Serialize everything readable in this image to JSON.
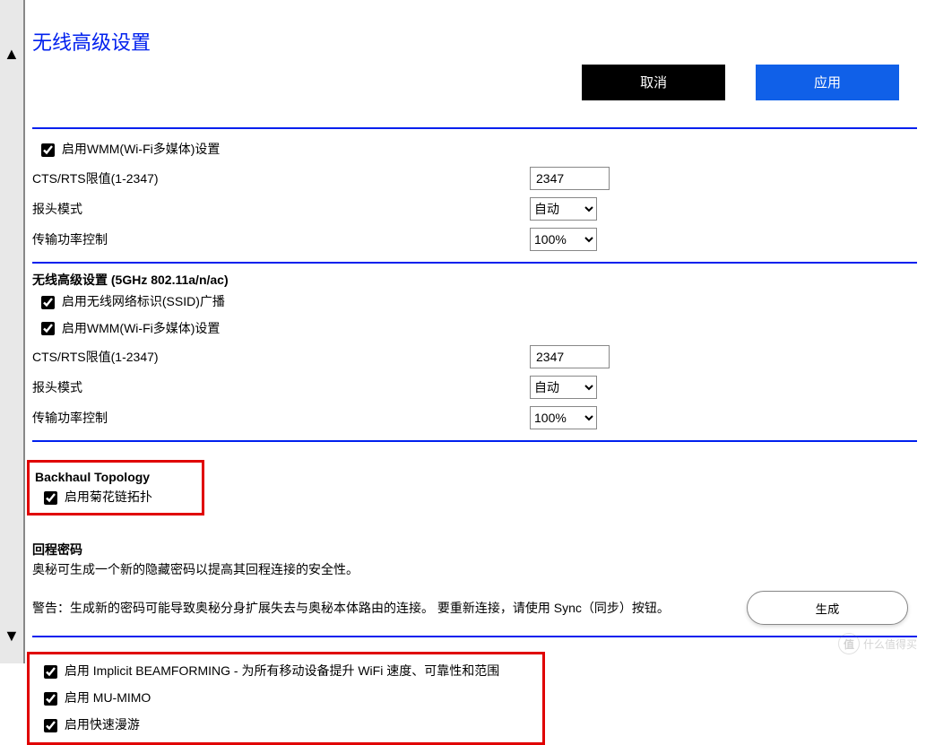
{
  "page_title": "无线高级设置",
  "buttons": {
    "cancel": "取消",
    "apply": "应用"
  },
  "section1": {
    "wmm_label": "启用WMM(Wi-Fi多媒体)设置",
    "cts_label": "CTS/RTS限值(1-2347)",
    "cts_value": "2347",
    "preamble_label": "报头模式",
    "preamble_value": "自动",
    "power_label": "传输功率控制",
    "power_value": "100%"
  },
  "section2": {
    "heading": "无线高级设置 (5GHz 802.11a/n/ac)",
    "ssid_label": "启用无线网络标识(SSID)广播",
    "wmm_label": "启用WMM(Wi-Fi多媒体)设置",
    "cts_label": "CTS/RTS限值(1-2347)",
    "cts_value": "2347",
    "preamble_label": "报头模式",
    "preamble_value": "自动",
    "power_label": "传输功率控制",
    "power_value": "100%"
  },
  "backhaul": {
    "heading": "Backhaul Topology",
    "daisy_label": "启用菊花链拓扑"
  },
  "return_pw": {
    "heading": "回程密码",
    "desc": "奥秘可生成一个新的隐藏密码以提高其回程连接的安全性。",
    "warning": "警告：生成新的密码可能导致奥秘分身扩展失去与奥秘本体路由的连接。 要重新连接，请使用 Sync（同步）按钮。",
    "generate": "生成"
  },
  "features": {
    "bf_label": "启用 Implicit BEAMFORMING - 为所有移动设备提升 WiFi 速度、可靠性和范围",
    "mu_label": "启用 MU-MIMO",
    "roam_label": "启用快速漫游"
  },
  "watermark": "什么值得买"
}
